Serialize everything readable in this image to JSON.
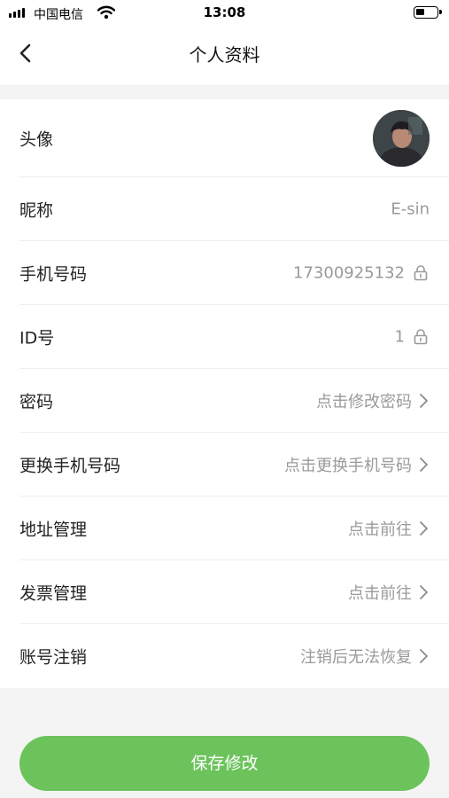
{
  "status_bar": {
    "carrier": "中国电信",
    "time": "13:08"
  },
  "nav": {
    "title": "个人资料"
  },
  "rows": [
    {
      "label": "头像"
    },
    {
      "label": "昵称",
      "value": "E-sin"
    },
    {
      "label": "手机号码",
      "value": "17300925132",
      "icon": "lock-icon"
    },
    {
      "label": "ID号",
      "value": "1",
      "icon": "lock-icon"
    },
    {
      "label": "密码",
      "value": "点击修改密码",
      "icon": "chevron-right-icon"
    },
    {
      "label": "更换手机号码",
      "value": "点击更换手机号码",
      "icon": "chevron-right-icon"
    },
    {
      "label": "地址管理",
      "value": "点击前往",
      "icon": "chevron-right-icon"
    },
    {
      "label": "发票管理",
      "value": "点击前往",
      "icon": "chevron-right-icon"
    },
    {
      "label": "账号注销",
      "value": "注销后无法恢复",
      "icon": "chevron-right-icon"
    }
  ],
  "footer": {
    "save_label": "保存修改"
  },
  "colors": {
    "accent": "#6cc35c",
    "value_text": "#9a9a9a",
    "background": "#f4f4f4"
  }
}
